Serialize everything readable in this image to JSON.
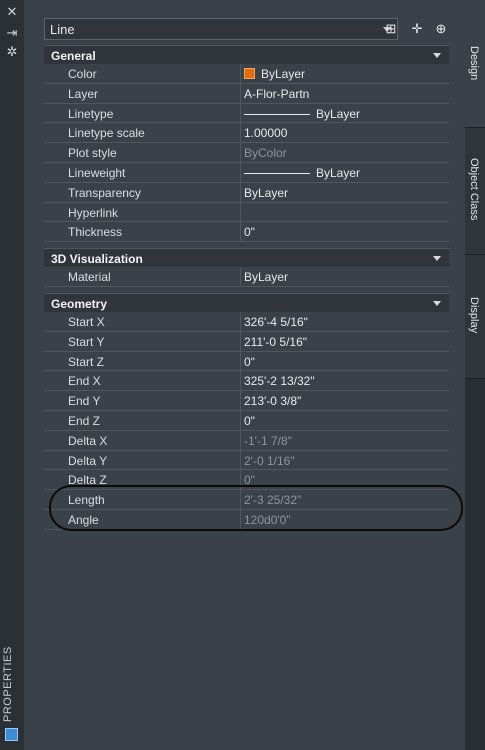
{
  "palette": {
    "title": "PROPERTIES"
  },
  "object_selector": {
    "value": "Line"
  },
  "tabs": [
    {
      "label": "Design"
    },
    {
      "label": "Object Class"
    },
    {
      "label": "Display"
    }
  ],
  "sections": {
    "general": {
      "title": "General",
      "rows": [
        {
          "name": "Color",
          "value": "ByLayer"
        },
        {
          "name": "Layer",
          "value": "A-Flor-Partn"
        },
        {
          "name": "Linetype",
          "value": "ByLayer"
        },
        {
          "name": "Linetype scale",
          "value": "1.00000"
        },
        {
          "name": "Plot style",
          "value": "ByColor"
        },
        {
          "name": "Lineweight",
          "value": "ByLayer"
        },
        {
          "name": "Transparency",
          "value": "ByLayer"
        },
        {
          "name": "Hyperlink",
          "value": ""
        },
        {
          "name": "Thickness",
          "value": "0\""
        }
      ]
    },
    "visualization": {
      "title": "3D Visualization",
      "rows": [
        {
          "name": "Material",
          "value": "ByLayer"
        }
      ]
    },
    "geometry": {
      "title": "Geometry",
      "rows": [
        {
          "name": "Start X",
          "value": "326'-4 5/16\""
        },
        {
          "name": "Start Y",
          "value": "211'-0 5/16\""
        },
        {
          "name": "Start Z",
          "value": "0\""
        },
        {
          "name": "End X",
          "value": "325'-2 13/32\""
        },
        {
          "name": "End Y",
          "value": "213'-0 3/8\""
        },
        {
          "name": "End Z",
          "value": "0\""
        },
        {
          "name": "Delta X",
          "value": "-1'-1 7/8\""
        },
        {
          "name": "Delta Y",
          "value": "2'-0 1/16\""
        },
        {
          "name": "Delta Z",
          "value": "0\""
        },
        {
          "name": "Length",
          "value": "2'-3 25/32\""
        },
        {
          "name": "Angle",
          "value": "120d0'0\""
        }
      ]
    }
  },
  "colors": {
    "swatch": "#e46c0a",
    "background": "#3b4148",
    "header": "#2f353b"
  }
}
